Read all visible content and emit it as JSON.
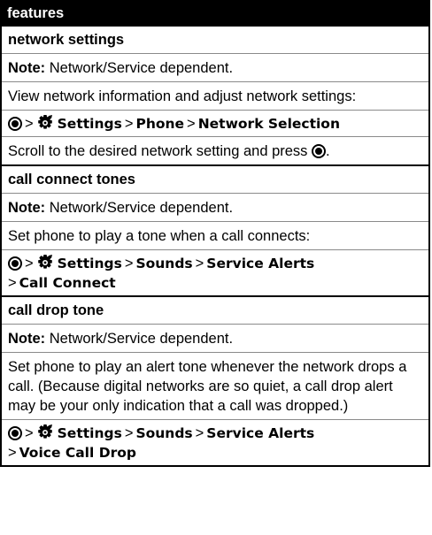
{
  "header": {
    "title": "features"
  },
  "icons": {
    "center_key": "center-select-key-icon",
    "settings": "settings-gear-icon"
  },
  "sections": [
    {
      "title": "network settings",
      "note_label": "Note:",
      "note_text": "Network/Service dependent.",
      "description": "View network information and adjust network settings:",
      "path": [
        "Settings",
        "Phone",
        "Network Selection"
      ],
      "extra_text": "Scroll to the desired network setting and press"
    },
    {
      "title": "call connect tones",
      "note_label": "Note:",
      "note_text": "Network/Service dependent.",
      "description": "Set phone to play a tone when a call connects:",
      "path": [
        "Settings",
        "Sounds",
        "Service Alerts",
        "Call Connect"
      ]
    },
    {
      "title": "call drop tone",
      "note_label": "Note:",
      "note_text": "Network/Service dependent.",
      "description": "Set phone to play an alert tone whenever the network drops a call. (Because digital networks are so quiet, a call drop alert may be your only indication that a call was dropped.)",
      "path": [
        "Settings",
        "Sounds",
        "Service Alerts",
        "Voice Call Drop"
      ]
    }
  ]
}
